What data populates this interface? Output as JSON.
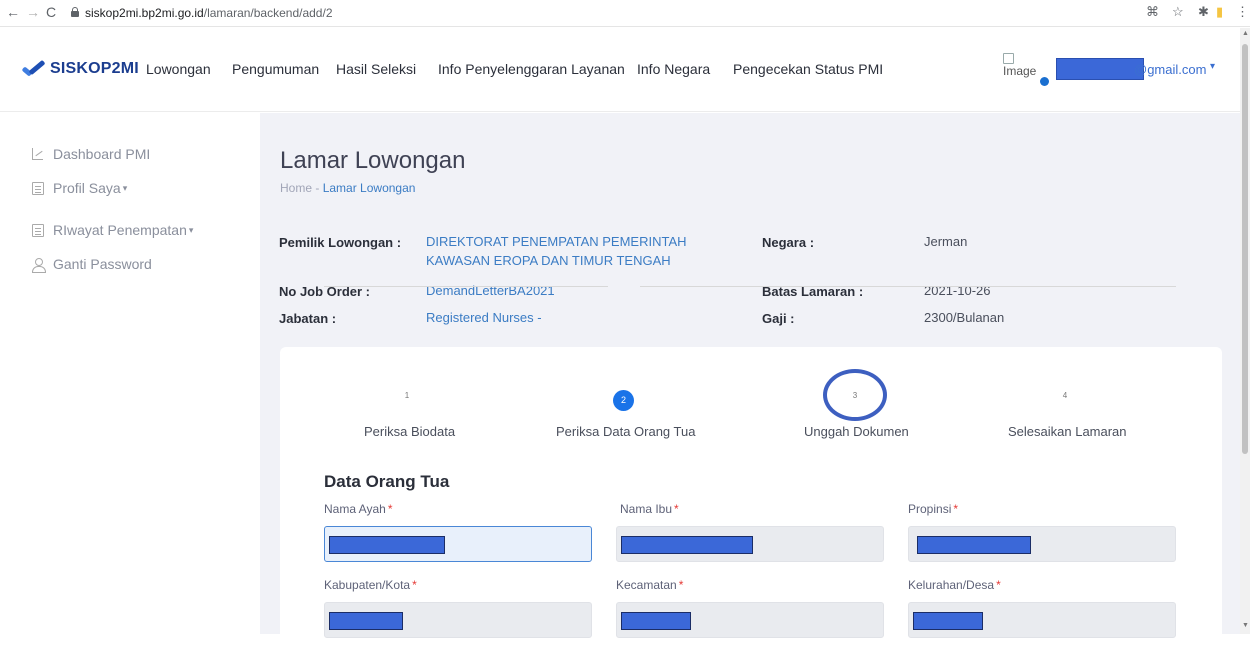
{
  "browser": {
    "back_icon": "←",
    "forward_icon": "→",
    "reload_icon": "C",
    "url_host": "siskop2mi.bp2mi.go.id",
    "url_path": "/lamaran/backend/add/2",
    "translate_icon": "⌘",
    "star_icon": "☆",
    "extensions_icon": "✱",
    "bookmark_icon": "▮",
    "menu_icon": "⋮"
  },
  "header": {
    "logo_text": "SISKOP2MI",
    "menu": [
      "Lowongan",
      "Pengumuman",
      "Hasil Seleksi",
      "Info Penyelenggaran Layanan",
      "Info Negara",
      "Pengecekan Status PMI"
    ],
    "image_alt": "Image",
    "user_email_suffix": "@gmail.com",
    "user_caret": "▾"
  },
  "sidebar": {
    "items": [
      {
        "label": "Dashboard PMI",
        "caret": ""
      },
      {
        "label": "Profil Saya",
        "caret": "▾"
      },
      {
        "label": "RIwayat Penempatan",
        "caret": "▾"
      },
      {
        "label": "Ganti Password",
        "caret": ""
      }
    ]
  },
  "page": {
    "title": "Lamar Lowongan",
    "breadcrumb_home": "Home",
    "breadcrumb_sep": "-",
    "breadcrumb_current": "Lamar Lowongan"
  },
  "job_info": {
    "owner_label": "Pemilik Lowongan :",
    "owner_line1": "DIREKTORAT PENEMPATAN PEMERINTAH",
    "owner_line2": "KAWASAN EROPA DAN TIMUR TENGAH",
    "job_order_label": "No Job Order :",
    "job_order_value": "DemandLetterBA2021",
    "position_label": "Jabatan :",
    "position_value": "Registered Nurses -",
    "country_label": "Negara :",
    "country_value": "Jerman",
    "deadline_label": "Batas Lamaran :",
    "deadline_value": "2021-10-26",
    "salary_label": "Gaji :",
    "salary_value": "2300/Bulanan"
  },
  "stepper": {
    "steps": [
      {
        "num": "1",
        "label": "Periksa Biodata"
      },
      {
        "num": "2",
        "label": "Periksa Data Orang Tua"
      },
      {
        "num": "3",
        "label": "Unggah Dokumen"
      },
      {
        "num": "4",
        "label": "Selesaikan Lamaran"
      }
    ],
    "active_step": 2
  },
  "form": {
    "section_title": "Data Orang Tua",
    "required_mark": "*",
    "fields": [
      {
        "label": "Nama Ayah"
      },
      {
        "label": "Nama Ibu"
      },
      {
        "label": "Propinsi"
      },
      {
        "label": "Kabupaten/Kota"
      },
      {
        "label": "Kecamatan"
      },
      {
        "label": "Kelurahan/Desa"
      }
    ]
  },
  "colors": {
    "accent": "#1a73e8",
    "link": "#3b7cc4",
    "redaction": "#3b68d8",
    "required": "#e53935"
  }
}
